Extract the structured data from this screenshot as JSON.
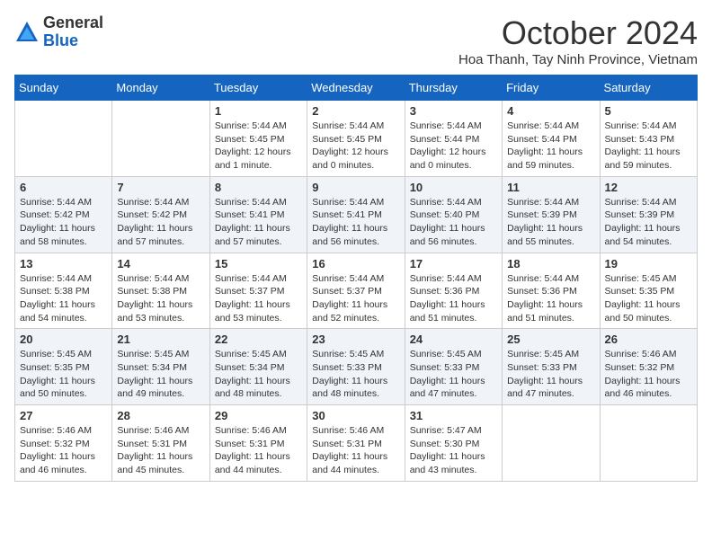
{
  "logo": {
    "general": "General",
    "blue": "Blue"
  },
  "header": {
    "month": "October 2024",
    "subtitle": "Hoa Thanh, Tay Ninh Province, Vietnam"
  },
  "weekdays": [
    "Sunday",
    "Monday",
    "Tuesday",
    "Wednesday",
    "Thursday",
    "Friday",
    "Saturday"
  ],
  "weeks": [
    [
      {
        "day": "",
        "info": ""
      },
      {
        "day": "",
        "info": ""
      },
      {
        "day": "1",
        "info": "Sunrise: 5:44 AM\nSunset: 5:45 PM\nDaylight: 12 hours and 1 minute."
      },
      {
        "day": "2",
        "info": "Sunrise: 5:44 AM\nSunset: 5:45 PM\nDaylight: 12 hours and 0 minutes."
      },
      {
        "day": "3",
        "info": "Sunrise: 5:44 AM\nSunset: 5:44 PM\nDaylight: 12 hours and 0 minutes."
      },
      {
        "day": "4",
        "info": "Sunrise: 5:44 AM\nSunset: 5:44 PM\nDaylight: 11 hours and 59 minutes."
      },
      {
        "day": "5",
        "info": "Sunrise: 5:44 AM\nSunset: 5:43 PM\nDaylight: 11 hours and 59 minutes."
      }
    ],
    [
      {
        "day": "6",
        "info": "Sunrise: 5:44 AM\nSunset: 5:42 PM\nDaylight: 11 hours and 58 minutes."
      },
      {
        "day": "7",
        "info": "Sunrise: 5:44 AM\nSunset: 5:42 PM\nDaylight: 11 hours and 57 minutes."
      },
      {
        "day": "8",
        "info": "Sunrise: 5:44 AM\nSunset: 5:41 PM\nDaylight: 11 hours and 57 minutes."
      },
      {
        "day": "9",
        "info": "Sunrise: 5:44 AM\nSunset: 5:41 PM\nDaylight: 11 hours and 56 minutes."
      },
      {
        "day": "10",
        "info": "Sunrise: 5:44 AM\nSunset: 5:40 PM\nDaylight: 11 hours and 56 minutes."
      },
      {
        "day": "11",
        "info": "Sunrise: 5:44 AM\nSunset: 5:39 PM\nDaylight: 11 hours and 55 minutes."
      },
      {
        "day": "12",
        "info": "Sunrise: 5:44 AM\nSunset: 5:39 PM\nDaylight: 11 hours and 54 minutes."
      }
    ],
    [
      {
        "day": "13",
        "info": "Sunrise: 5:44 AM\nSunset: 5:38 PM\nDaylight: 11 hours and 54 minutes."
      },
      {
        "day": "14",
        "info": "Sunrise: 5:44 AM\nSunset: 5:38 PM\nDaylight: 11 hours and 53 minutes."
      },
      {
        "day": "15",
        "info": "Sunrise: 5:44 AM\nSunset: 5:37 PM\nDaylight: 11 hours and 53 minutes."
      },
      {
        "day": "16",
        "info": "Sunrise: 5:44 AM\nSunset: 5:37 PM\nDaylight: 11 hours and 52 minutes."
      },
      {
        "day": "17",
        "info": "Sunrise: 5:44 AM\nSunset: 5:36 PM\nDaylight: 11 hours and 51 minutes."
      },
      {
        "day": "18",
        "info": "Sunrise: 5:44 AM\nSunset: 5:36 PM\nDaylight: 11 hours and 51 minutes."
      },
      {
        "day": "19",
        "info": "Sunrise: 5:45 AM\nSunset: 5:35 PM\nDaylight: 11 hours and 50 minutes."
      }
    ],
    [
      {
        "day": "20",
        "info": "Sunrise: 5:45 AM\nSunset: 5:35 PM\nDaylight: 11 hours and 50 minutes."
      },
      {
        "day": "21",
        "info": "Sunrise: 5:45 AM\nSunset: 5:34 PM\nDaylight: 11 hours and 49 minutes."
      },
      {
        "day": "22",
        "info": "Sunrise: 5:45 AM\nSunset: 5:34 PM\nDaylight: 11 hours and 48 minutes."
      },
      {
        "day": "23",
        "info": "Sunrise: 5:45 AM\nSunset: 5:33 PM\nDaylight: 11 hours and 48 minutes."
      },
      {
        "day": "24",
        "info": "Sunrise: 5:45 AM\nSunset: 5:33 PM\nDaylight: 11 hours and 47 minutes."
      },
      {
        "day": "25",
        "info": "Sunrise: 5:45 AM\nSunset: 5:33 PM\nDaylight: 11 hours and 47 minutes."
      },
      {
        "day": "26",
        "info": "Sunrise: 5:46 AM\nSunset: 5:32 PM\nDaylight: 11 hours and 46 minutes."
      }
    ],
    [
      {
        "day": "27",
        "info": "Sunrise: 5:46 AM\nSunset: 5:32 PM\nDaylight: 11 hours and 46 minutes."
      },
      {
        "day": "28",
        "info": "Sunrise: 5:46 AM\nSunset: 5:31 PM\nDaylight: 11 hours and 45 minutes."
      },
      {
        "day": "29",
        "info": "Sunrise: 5:46 AM\nSunset: 5:31 PM\nDaylight: 11 hours and 44 minutes."
      },
      {
        "day": "30",
        "info": "Sunrise: 5:46 AM\nSunset: 5:31 PM\nDaylight: 11 hours and 44 minutes."
      },
      {
        "day": "31",
        "info": "Sunrise: 5:47 AM\nSunset: 5:30 PM\nDaylight: 11 hours and 43 minutes."
      },
      {
        "day": "",
        "info": ""
      },
      {
        "day": "",
        "info": ""
      }
    ]
  ]
}
